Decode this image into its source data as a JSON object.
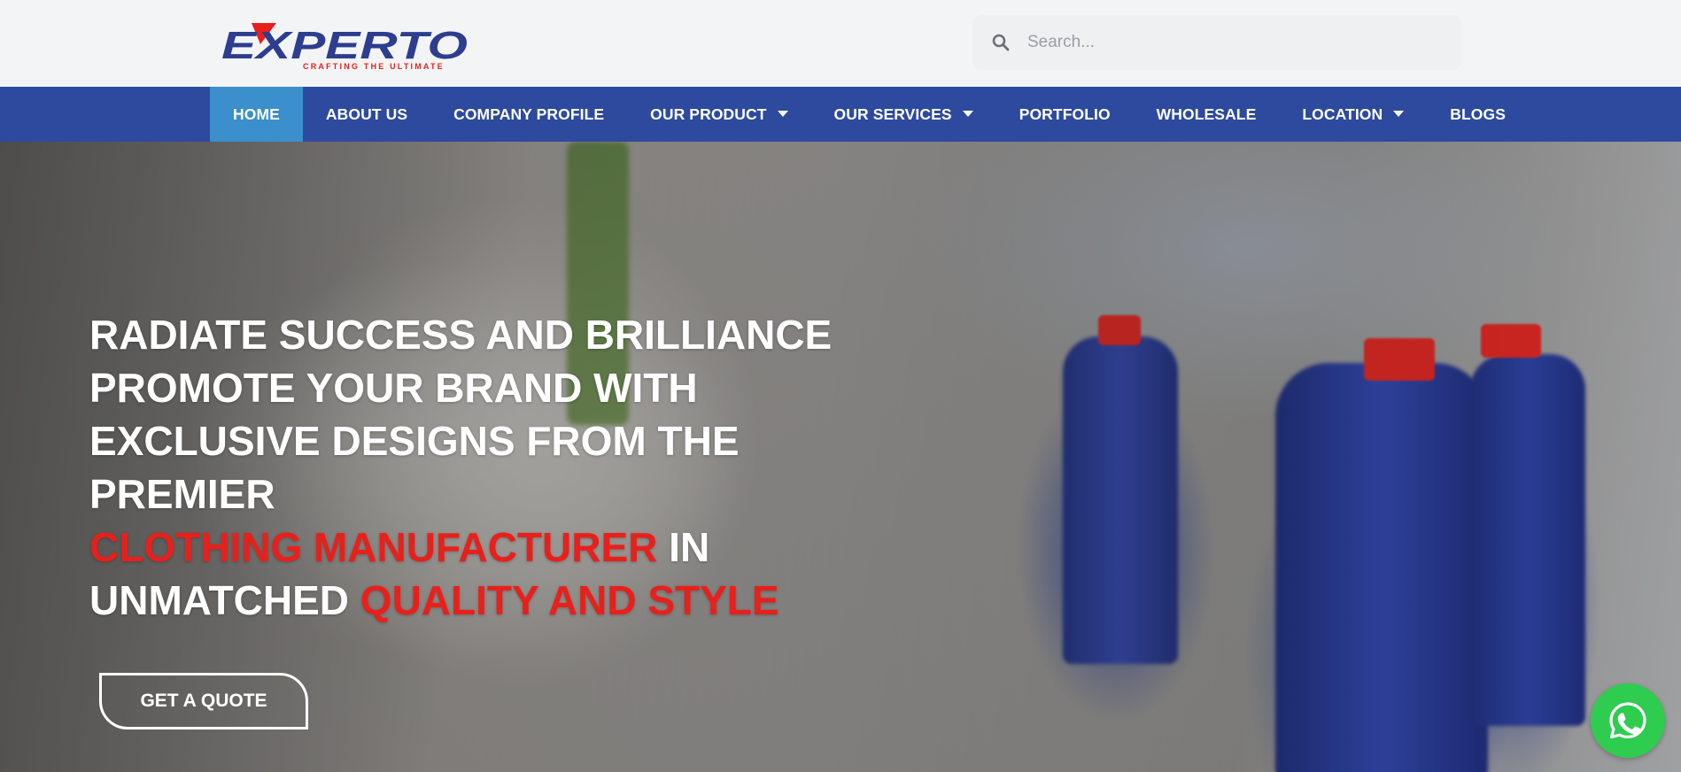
{
  "brand": {
    "name": "EXPERTO",
    "tagline": "CRAFTING THE ULTIMATE",
    "colors": {
      "blue": "#2d3d8f",
      "red": "#e8201c"
    }
  },
  "search": {
    "placeholder": "Search...",
    "value": "",
    "icon": "magnifier-icon"
  },
  "nav": {
    "background": "#2d4a9f",
    "active_color": "#3a8fcc",
    "items": [
      {
        "label": "HOME",
        "active": true,
        "has_dropdown": false
      },
      {
        "label": "ABOUT US",
        "active": false,
        "has_dropdown": false
      },
      {
        "label": "COMPANY PROFILE",
        "active": false,
        "has_dropdown": false
      },
      {
        "label": "OUR PRODUCT",
        "active": false,
        "has_dropdown": true
      },
      {
        "label": "OUR SERVICES",
        "active": false,
        "has_dropdown": true
      },
      {
        "label": "PORTFOLIO",
        "active": false,
        "has_dropdown": false
      },
      {
        "label": "WHOLESALE",
        "active": false,
        "has_dropdown": false
      },
      {
        "label": "LOCATION",
        "active": false,
        "has_dropdown": true
      },
      {
        "label": "BLOGS",
        "active": false,
        "has_dropdown": false
      }
    ]
  },
  "hero": {
    "lines": [
      "RADIATE SUCCESS AND BRILLIANCE",
      "PROMOTE YOUR BRAND WITH",
      "EXCLUSIVE DESIGNS FROM THE",
      "PREMIER"
    ],
    "line5_red": "CLOTHING MANUFACTURER",
    "line5_white": " IN",
    "line6_white": "UNMATCHED ",
    "line6_red": "QUALITY AND STYLE",
    "cta_label": "GET A QUOTE",
    "accent_color": "#e8201c"
  },
  "floating": {
    "whatsapp_icon": "whatsapp-icon",
    "color": "#2ecc4f"
  }
}
